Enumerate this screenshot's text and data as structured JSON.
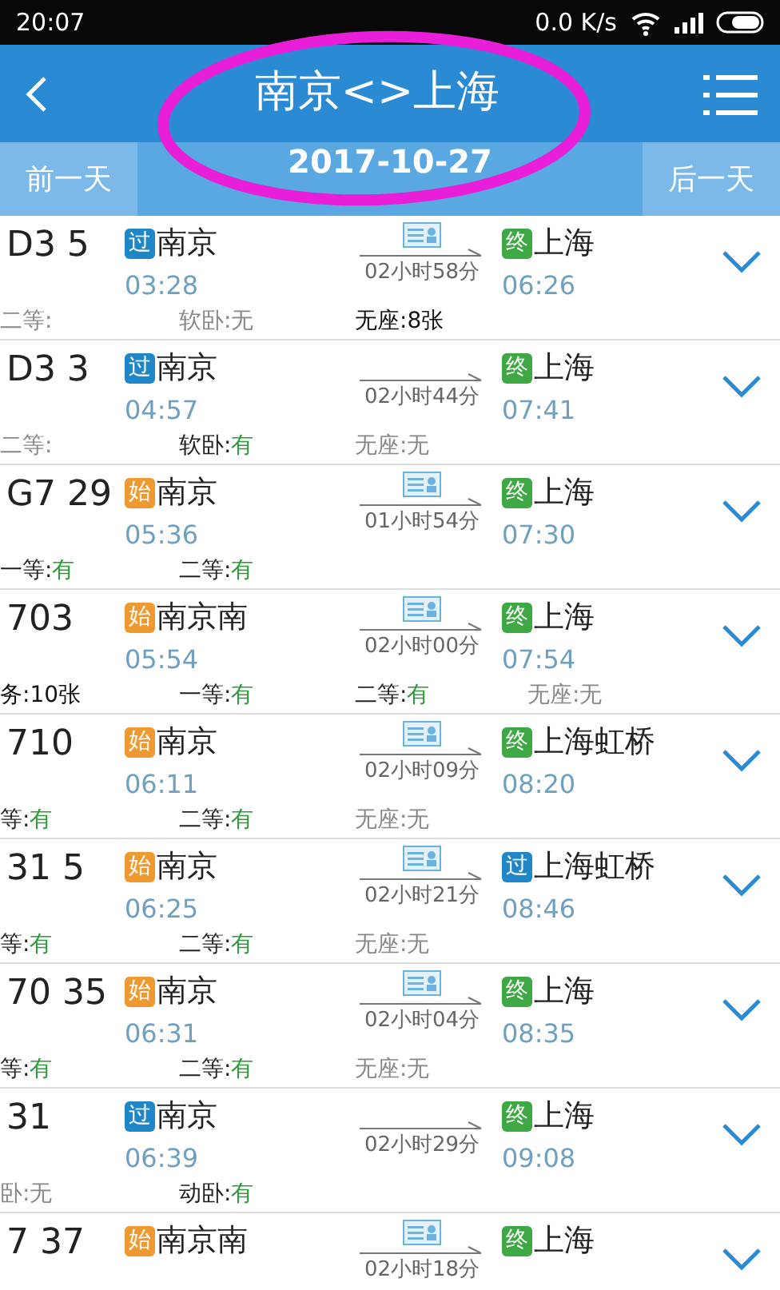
{
  "status_bar": {
    "time": "20:07",
    "speed": "0.0 K/s"
  },
  "header": {
    "title": "南京<>上海"
  },
  "date_bar": {
    "prev": "前一天",
    "date": "2017-10-27",
    "next": "后一天"
  },
  "trains": [
    {
      "number": "D3 5",
      "from": {
        "tag": "过",
        "kind": "pass",
        "station": "南京",
        "time": "03:28"
      },
      "duration": "02小时58分",
      "ticket_icon": true,
      "to": {
        "tag": "终",
        "kind": "end",
        "station": "上海",
        "time": "06:26"
      },
      "seats": [
        {
          "label": "二等:",
          "kind": "none"
        },
        {
          "label": "软卧:",
          "value": "无",
          "kind": "none"
        },
        {
          "label": "无座:",
          "value": "8张",
          "kind": "count"
        }
      ]
    },
    {
      "number": "D3 3",
      "from": {
        "tag": "过",
        "kind": "pass",
        "station": "南京",
        "time": "04:57"
      },
      "duration": "02小时44分",
      "ticket_icon": false,
      "to": {
        "tag": "终",
        "kind": "end",
        "station": "上海",
        "time": "07:41"
      },
      "seats": [
        {
          "label": "二等:",
          "kind": "none"
        },
        {
          "label": "软卧:",
          "value": "有",
          "kind": "yes"
        },
        {
          "label": "无座:",
          "value": "无",
          "kind": "none"
        }
      ]
    },
    {
      "number": "G7 29",
      "from": {
        "tag": "始",
        "kind": "start",
        "station": "南京",
        "time": "05:36"
      },
      "duration": "01小时54分",
      "ticket_icon": true,
      "to": {
        "tag": "终",
        "kind": "end",
        "station": "上海",
        "time": "07:30"
      },
      "seats": [
        {
          "label": "一等:",
          "value": "有",
          "kind": "yes"
        },
        {
          "label": "二等:",
          "value": "有",
          "kind": "yes"
        }
      ]
    },
    {
      "number": "703",
      "from": {
        "tag": "始",
        "kind": "start",
        "station": "南京南",
        "time": "05:54"
      },
      "duration": "02小时00分",
      "ticket_icon": true,
      "to": {
        "tag": "终",
        "kind": "end",
        "station": "上海",
        "time": "07:54"
      },
      "seats": [
        {
          "label": "务:",
          "value": "10张",
          "kind": "count"
        },
        {
          "label": "一等:",
          "value": "有",
          "kind": "yes"
        },
        {
          "label": "二等:",
          "value": "有",
          "kind": "yes"
        },
        {
          "label": "无座:",
          "value": "无",
          "kind": "none"
        }
      ]
    },
    {
      "number": "710",
      "from": {
        "tag": "始",
        "kind": "start",
        "station": "南京",
        "time": "06:11"
      },
      "duration": "02小时09分",
      "ticket_icon": true,
      "to": {
        "tag": "终",
        "kind": "end",
        "station": "上海虹桥",
        "time": "08:20"
      },
      "seats": [
        {
          "label": "等:",
          "value": "有",
          "kind": "yes"
        },
        {
          "label": "二等:",
          "value": "有",
          "kind": "yes"
        },
        {
          "label": "无座:",
          "value": "无",
          "kind": "none"
        }
      ]
    },
    {
      "number": "31 5",
      "from": {
        "tag": "始",
        "kind": "start",
        "station": "南京",
        "time": "06:25"
      },
      "duration": "02小时21分",
      "ticket_icon": true,
      "to": {
        "tag": "过",
        "kind": "pass",
        "station": "上海虹桥",
        "time": "08:46"
      },
      "seats": [
        {
          "label": "等:",
          "value": "有",
          "kind": "yes"
        },
        {
          "label": "二等:",
          "value": "有",
          "kind": "yes"
        },
        {
          "label": "无座:",
          "value": "无",
          "kind": "none"
        }
      ]
    },
    {
      "number": "70 35",
      "from": {
        "tag": "始",
        "kind": "start",
        "station": "南京",
        "time": "06:31"
      },
      "duration": "02小时04分",
      "ticket_icon": true,
      "to": {
        "tag": "终",
        "kind": "end",
        "station": "上海",
        "time": "08:35"
      },
      "seats": [
        {
          "label": "等:",
          "value": "有",
          "kind": "yes"
        },
        {
          "label": "二等:",
          "value": "有",
          "kind": "yes"
        },
        {
          "label": "无座:",
          "value": "无",
          "kind": "none"
        }
      ]
    },
    {
      "number": "31",
      "from": {
        "tag": "过",
        "kind": "pass",
        "station": "南京",
        "time": "06:39"
      },
      "duration": "02小时29分",
      "ticket_icon": false,
      "to": {
        "tag": "终",
        "kind": "end",
        "station": "上海",
        "time": "09:08"
      },
      "seats": [
        {
          "label": "卧:",
          "value": "无",
          "kind": "none"
        },
        {
          "label": "动卧:",
          "value": "有",
          "kind": "yes"
        }
      ]
    },
    {
      "number": "7 37",
      "from": {
        "tag": "始",
        "kind": "start",
        "station": "南京南"
      },
      "duration": "02小时18分",
      "ticket_icon": true,
      "to": {
        "tag": "终",
        "kind": "end",
        "station": "上海"
      }
    }
  ]
}
